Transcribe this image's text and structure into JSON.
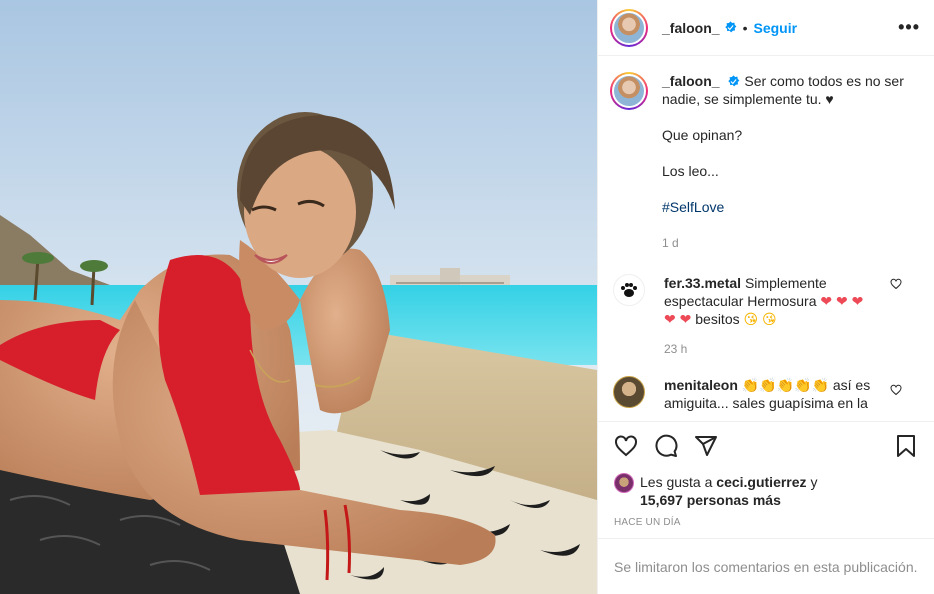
{
  "post": {
    "image_alt": "Woman in a red bikini lying on a patterned towel at a beach"
  },
  "header": {
    "username": "_faloon_",
    "separator": "•",
    "follow_label": "Seguir",
    "more_label": "•••"
  },
  "caption": {
    "username": "_faloon_",
    "line1": "Ser como todos es no ser nadie, se simplemente tu. ♥",
    "line2": "Que opinan?",
    "line3": "Los leo...",
    "hashtag": "#SelfLove",
    "time": "1 d"
  },
  "comments": [
    {
      "username": "fer.33.metal",
      "text": "Simplemente espectacular Hermosura",
      "hearts_a": "❤ ❤ ❤",
      "hearts_b": "❤ ❤",
      "text_b": "besitos",
      "emoji": "😘 😘",
      "time": "23 h"
    },
    {
      "username": "menitaleon",
      "emoji": "👏👏👏👏👏",
      "text": "así es amiguita... sales guapísima en la"
    }
  ],
  "likes": {
    "prefix": "Les gusta a",
    "user": "ceci.gutierrez",
    "and": "y",
    "count": "15,697 personas más"
  },
  "time_ago": "Hace un día",
  "comments_limited": "Se limitaron los comentarios en esta publicación.",
  "colors": {
    "accent": "#0095f6",
    "text": "#262626",
    "muted": "#8e8e8e",
    "border": "#efefef",
    "heart": "#ed4956"
  },
  "icons": [
    "verified-badge-icon",
    "heart-icon",
    "comment-icon",
    "share-icon",
    "bookmark-icon",
    "more-icon",
    "paw-icon"
  ]
}
